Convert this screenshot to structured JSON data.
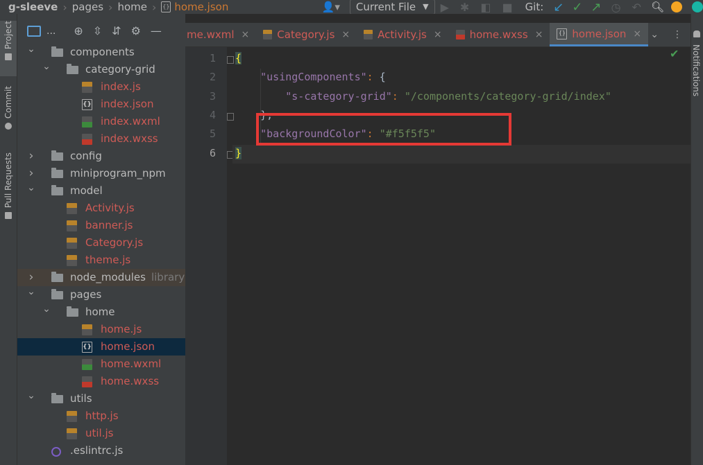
{
  "breadcrumb": {
    "project": "g-sleeve",
    "items": [
      "pages",
      "home"
    ],
    "file": "home.json"
  },
  "toolbar": {
    "run_config": "Current File",
    "git_label": "Git:"
  },
  "left_strip": {
    "tabs": [
      "Project",
      "Commit",
      "Pull Requests"
    ]
  },
  "project_panel": {
    "title": "..."
  },
  "tree": [
    {
      "label": "components",
      "type": "folder",
      "depth": 1,
      "expanded": true
    },
    {
      "label": "category-grid",
      "type": "folder",
      "depth": 2,
      "expanded": true
    },
    {
      "label": "index.js",
      "type": "js",
      "depth": 3
    },
    {
      "label": "index.json",
      "type": "json",
      "depth": 3
    },
    {
      "label": "index.wxml",
      "type": "wxml",
      "depth": 3
    },
    {
      "label": "index.wxss",
      "type": "wxss",
      "depth": 3
    },
    {
      "label": "config",
      "type": "folder",
      "depth": 1,
      "expanded": false
    },
    {
      "label": "miniprogram_npm",
      "type": "folder",
      "depth": 1,
      "expanded": false
    },
    {
      "label": "model",
      "type": "folder",
      "depth": 1,
      "expanded": true
    },
    {
      "label": "Activity.js",
      "type": "js",
      "depth": 2
    },
    {
      "label": "banner.js",
      "type": "js",
      "depth": 2
    },
    {
      "label": "Category.js",
      "type": "js",
      "depth": 2
    },
    {
      "label": "theme.js",
      "type": "js",
      "depth": 2
    },
    {
      "label": "node_modules",
      "type": "folder",
      "depth": 1,
      "expanded": false,
      "tag": "library",
      "excluded": true
    },
    {
      "label": "pages",
      "type": "folder",
      "depth": 1,
      "expanded": true
    },
    {
      "label": "home",
      "type": "folder",
      "depth": 2,
      "expanded": true
    },
    {
      "label": "home.js",
      "type": "js",
      "depth": 3
    },
    {
      "label": "home.json",
      "type": "json",
      "depth": 3,
      "selected": true
    },
    {
      "label": "home.wxml",
      "type": "wxml",
      "depth": 3
    },
    {
      "label": "home.wxss",
      "type": "wxss",
      "depth": 3
    },
    {
      "label": "utils",
      "type": "folder",
      "depth": 1,
      "expanded": true
    },
    {
      "label": "http.js",
      "type": "js",
      "depth": 2
    },
    {
      "label": "util.js",
      "type": "js",
      "depth": 2
    },
    {
      "label": ".eslintrc.js",
      "type": "eslint",
      "depth": 1
    }
  ],
  "tabs": [
    {
      "label": "me.wxml",
      "icon": "none"
    },
    {
      "label": "Category.js",
      "icon": "js"
    },
    {
      "label": "Activity.js",
      "icon": "js"
    },
    {
      "label": "home.wxss",
      "icon": "wxss"
    },
    {
      "label": "home.json",
      "icon": "json",
      "active": true
    }
  ],
  "editor": {
    "line_numbers": [
      "1",
      "2",
      "3",
      "4",
      "5",
      "6"
    ],
    "current_line": 6,
    "lines": [
      [
        {
          "t": "{",
          "c": "brace-hl"
        }
      ],
      [
        {
          "t": "    "
        },
        {
          "t": "\"usingComponents\"",
          "c": "tk-key"
        },
        {
          "t": ": ",
          "c": "tk-punc"
        },
        {
          "t": "{",
          "c": "tk-brace"
        }
      ],
      [
        {
          "t": "        "
        },
        {
          "t": "\"s-category-grid\"",
          "c": "tk-key"
        },
        {
          "t": ": ",
          "c": "tk-punc"
        },
        {
          "t": "\"/components/category-grid/index\"",
          "c": "tk-str"
        }
      ],
      [
        {
          "t": "    "
        },
        {
          "t": "},",
          "c": "tk-brace"
        }
      ],
      [
        {
          "t": "    "
        },
        {
          "t": "\"backgroundColor\"",
          "c": "tk-key"
        },
        {
          "t": ": ",
          "c": "tk-punc"
        },
        {
          "t": "\"#f5f5f5\"",
          "c": "tk-str"
        }
      ],
      [
        {
          "t": "}",
          "c": "brace-hl"
        }
      ]
    ]
  },
  "right_strip": {
    "label": "Notifications"
  },
  "colors": {
    "accent": "#4a88c7",
    "highlight_box": "#e53935",
    "file_modified": "#cf5b56"
  }
}
